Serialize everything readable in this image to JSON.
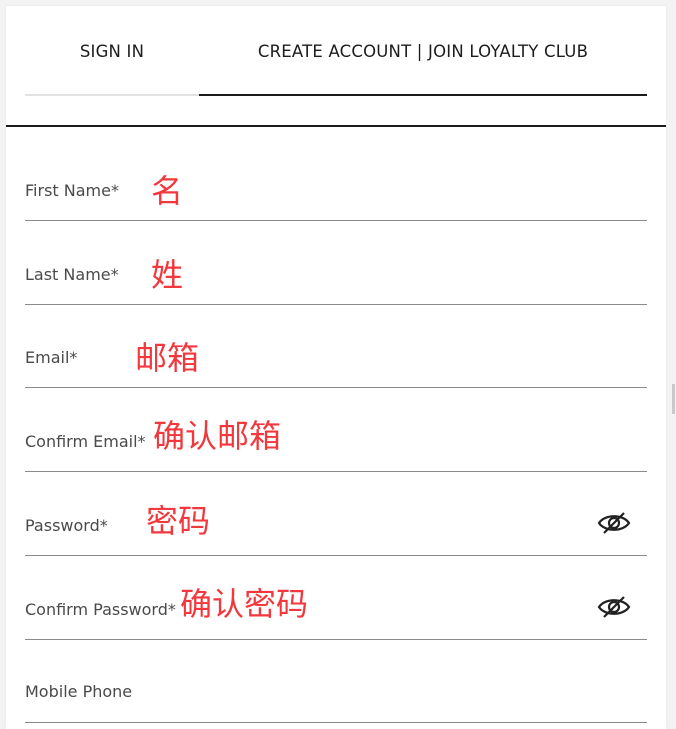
{
  "tabs": {
    "sign_in": "SIGN IN",
    "create_account": "CREATE ACCOUNT | JOIN LOYALTY CLUB"
  },
  "fields": [
    {
      "label": "First Name*",
      "annotation": "名"
    },
    {
      "label": "Last Name*",
      "annotation": "姓"
    },
    {
      "label": "Email*",
      "annotation": "邮箱"
    },
    {
      "label": "Confirm Email*",
      "annotation": "确认邮箱"
    },
    {
      "label": "Password*",
      "annotation": "密码",
      "icon": "eye-slash-icon"
    },
    {
      "label": "Confirm Password*",
      "annotation": "确认密码",
      "icon": "eye-slash-icon"
    },
    {
      "label": "Mobile Phone"
    }
  ],
  "colors": {
    "annotation": "#f2383d",
    "active_tab_underline": "#1b1b1b",
    "inactive_tab_underline": "#e2e2e2",
    "field_line": "#8a8a8a"
  }
}
